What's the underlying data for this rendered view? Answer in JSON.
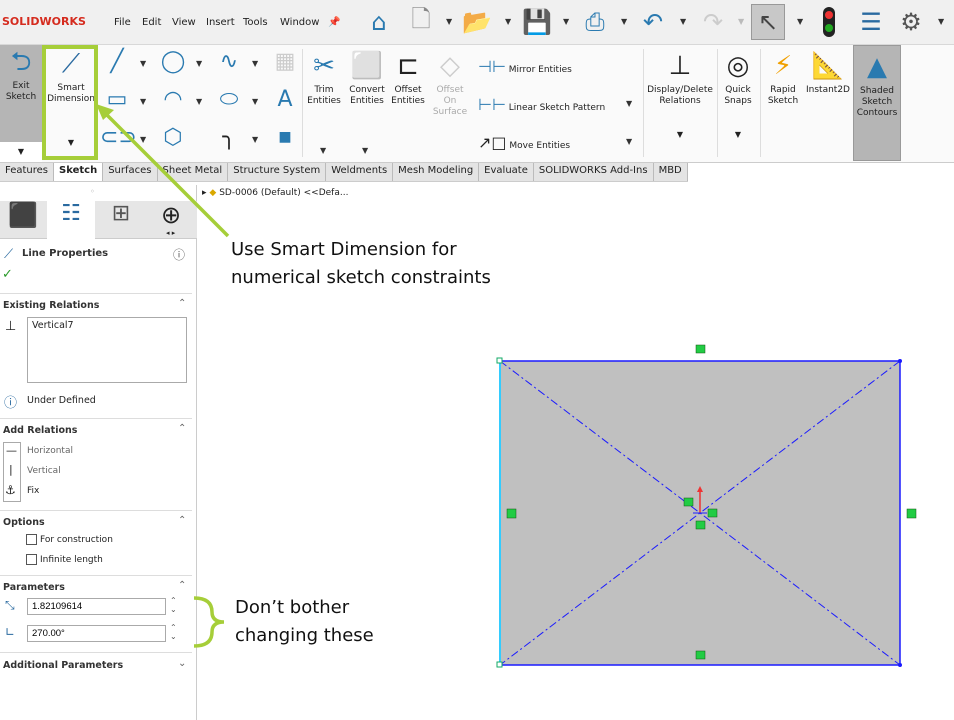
{
  "app": {
    "logo": "SOLIDWORKS"
  },
  "menu": [
    "File",
    "Edit",
    "View",
    "Insert",
    "Tools",
    "Window"
  ],
  "ribbon": {
    "exit_sketch": "Exit Sketch",
    "smart_dimension": "Smart Dimension",
    "trim": "Trim Entities",
    "convert": "Convert Entities",
    "offset": "Offset Entities",
    "offset_surface": "Offset On Surface",
    "mirror": "Mirror Entities",
    "linear_pattern": "Linear Sketch Pattern",
    "move": "Move Entities",
    "display_delete": "Display/Delete Relations",
    "quick_snaps": "Quick Snaps",
    "rapid_sketch": "Rapid Sketch",
    "instant2d": "Instant2D",
    "shaded": "Shaded Sketch Contours"
  },
  "tabs": [
    "Features",
    "Sketch",
    "Surfaces",
    "Sheet Metal",
    "Structure System",
    "Weldments",
    "Mesh Modeling",
    "Evaluate",
    "SOLIDWORKS Add-Ins",
    "MBD"
  ],
  "active_tab": "Sketch",
  "tree": {
    "item": "SD-0006 (Default) <<Defa..."
  },
  "panel": {
    "title": "Line Properties",
    "existing_relations": {
      "header": "Existing Relations",
      "items": [
        "Vertical7"
      ],
      "status": "Under Defined"
    },
    "add_relations": {
      "header": "Add Relations",
      "items": [
        "Horizontal",
        "Vertical",
        "Fix"
      ]
    },
    "options": {
      "header": "Options",
      "items": [
        {
          "label": "For construction",
          "checked": false
        },
        {
          "label": "Infinite length",
          "checked": false
        }
      ]
    },
    "parameters": {
      "header": "Parameters",
      "length": "1.82109614",
      "angle": "270.00°"
    },
    "additional": "Additional Parameters"
  },
  "annotations": {
    "smart_dim": "Use Smart Dimension for numerical sketch constraints",
    "params": "Don’t bother changing these"
  },
  "colors": {
    "highlight": "#a6ce39",
    "sketch_line": "#1a1aff",
    "selected": "#33ccff",
    "fill": "#c0c0c0",
    "relation": "#22cc44"
  }
}
